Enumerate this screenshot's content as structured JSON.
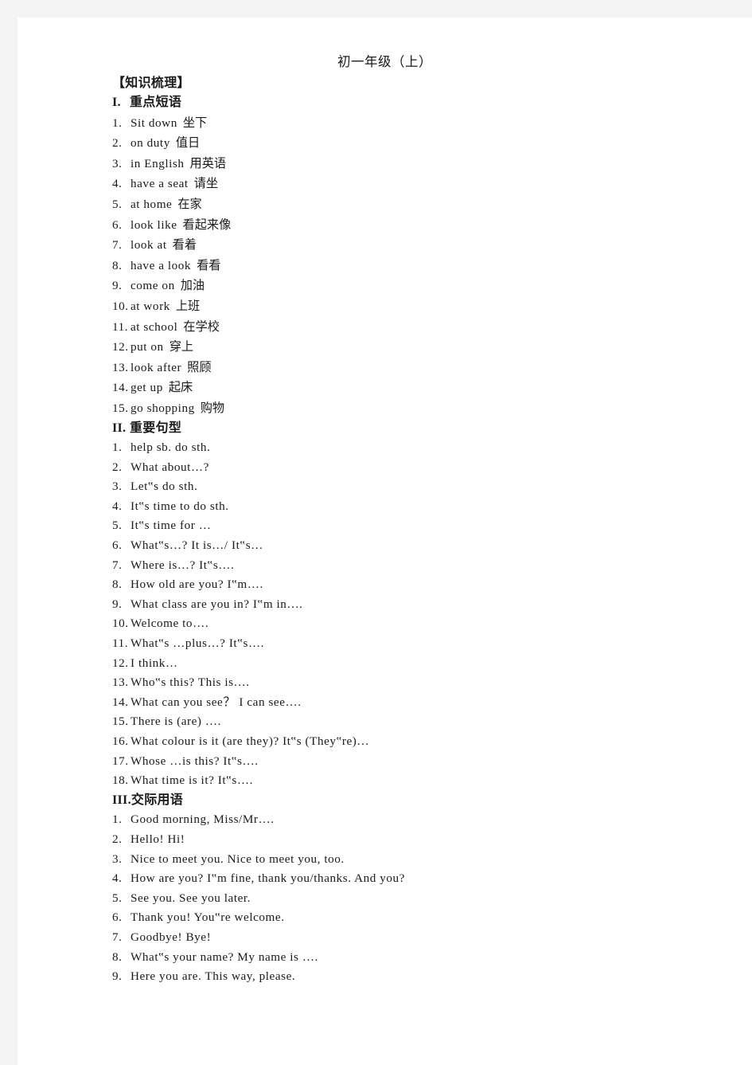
{
  "document": {
    "title": "初一年级（上）",
    "overview_heading": "【知识梳理】"
  },
  "sections": [
    {
      "numeral": "I.",
      "heading": "重点短语",
      "items": [
        {
          "index": "1.",
          "english": "Sit down",
          "chinese": "坐下"
        },
        {
          "index": "2.",
          "english": "on duty",
          "chinese": "值日"
        },
        {
          "index": "3.",
          "english": "in English",
          "chinese": "用英语"
        },
        {
          "index": "4.",
          "english": "have a seat",
          "chinese": "请坐"
        },
        {
          "index": "5.",
          "english": "at home",
          "chinese": "在家"
        },
        {
          "index": "6.",
          "english": "look like",
          "chinese": "看起来像"
        },
        {
          "index": "7.",
          "english": "look at",
          "chinese": "看着"
        },
        {
          "index": "8.",
          "english": "have a look",
          "chinese": "看看"
        },
        {
          "index": "9.",
          "english": "come on",
          "chinese": "加油"
        },
        {
          "index": "10.",
          "english": "at work",
          "chinese": "上班"
        },
        {
          "index": "11.",
          "english": "at school",
          "chinese": "在学校"
        },
        {
          "index": "12.",
          "english": "put on",
          "chinese": "穿上"
        },
        {
          "index": "13.",
          "english": "look after",
          "chinese": "照顾"
        },
        {
          "index": "14.",
          "english": "get up",
          "chinese": "起床"
        },
        {
          "index": "15.",
          "english": "go shopping",
          "chinese": "购物"
        }
      ]
    },
    {
      "numeral": "II.",
      "heading": "重要句型",
      "items": [
        {
          "index": "1.",
          "english": "help sb. do sth.",
          "chinese": ""
        },
        {
          "index": "2.",
          "english": "What about…?",
          "chinese": ""
        },
        {
          "index": "3.",
          "english": "Let‟s do sth.",
          "chinese": ""
        },
        {
          "index": "4.",
          "english": "It‟s time to do sth.",
          "chinese": ""
        },
        {
          "index": "5.",
          "english": "It‟s time for …",
          "chinese": ""
        },
        {
          "index": "6.",
          "english": "What‟s…? It is…/ It‟s…",
          "chinese": ""
        },
        {
          "index": "7.",
          "english": "Where is…? It‟s….",
          "chinese": ""
        },
        {
          "index": "8.",
          "english": "How old are you? I‟m….",
          "chinese": ""
        },
        {
          "index": "9.",
          "english": "What class are you in? I‟m in….",
          "chinese": ""
        },
        {
          "index": "10.",
          "english": "Welcome to….",
          "chinese": ""
        },
        {
          "index": "11.",
          "english": "What‟s …plus…? It‟s….",
          "chinese": ""
        },
        {
          "index": "12.",
          "english": "I think…",
          "chinese": ""
        },
        {
          "index": "13.",
          "english": "Who‟s this? This is….",
          "chinese": ""
        },
        {
          "index": "14.",
          "english": "What can you see？ I can see….",
          "chinese": ""
        },
        {
          "index": "15.",
          "english": "There is (are) ….",
          "chinese": ""
        },
        {
          "index": "16.",
          "english": "What colour is it (are they)? It‟s (They‟re)…",
          "chinese": ""
        },
        {
          "index": "17.",
          "english": "Whose …is this? It‟s….",
          "chinese": ""
        },
        {
          "index": "18.",
          "english": "What time is it? It‟s….",
          "chinese": ""
        }
      ]
    },
    {
      "numeral": "III.",
      "heading": "交际用语",
      "items": [
        {
          "index": "1.",
          "english": "Good morning, Miss/Mr….",
          "chinese": ""
        },
        {
          "index": "2.",
          "english": "Hello! Hi!",
          "chinese": ""
        },
        {
          "index": "3.",
          "english": "Nice to meet you. Nice to meet you, too.",
          "chinese": ""
        },
        {
          "index": "4.",
          "english": "How are you? I‟m fine, thank you/thanks. And you?",
          "chinese": ""
        },
        {
          "index": "5.",
          "english": "See you. See you later.",
          "chinese": ""
        },
        {
          "index": "6.",
          "english": "Thank you! You‟re welcome.",
          "chinese": ""
        },
        {
          "index": "7.",
          "english": "Goodbye! Bye!",
          "chinese": ""
        },
        {
          "index": "8.",
          "english": "What‟s your name? My name is ….",
          "chinese": ""
        },
        {
          "index": "9.",
          "english": "Here you are. This way, please.",
          "chinese": ""
        }
      ]
    }
  ]
}
